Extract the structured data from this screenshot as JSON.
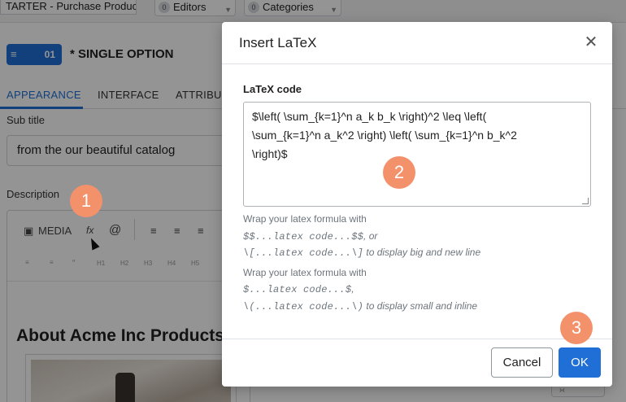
{
  "background": {
    "breadcrumb": "TARTER - Purchase Produc",
    "filters": [
      {
        "count": "0",
        "label": "Editors"
      },
      {
        "count": "0",
        "label": "Categories"
      }
    ],
    "type_badge": {
      "icon": "list-icon",
      "number": "01"
    },
    "page_title": "* SINGLE OPTION",
    "tabs": [
      "APPEARANCE",
      "INTERFACE",
      "ATTRIBUT"
    ],
    "subtitle_label": "Sub title",
    "subtitle_value": "from the our beautiful catalog",
    "description_label": "Description",
    "editor_toolbar": {
      "media": "MEDIA",
      "formula_icon": "fx",
      "mention_icon": "@",
      "align_icons": [
        "align-left-icon",
        "align-center-icon",
        "align-right-icon"
      ],
      "headings": [
        "H1",
        "H2",
        "H3",
        "H4",
        "H5"
      ]
    },
    "editor_heading": "About Acme Inc Products"
  },
  "modal": {
    "title": "Insert LaTeX",
    "field_label": "LaTeX code",
    "latex_value": "$\\left( \\sum_{k=1}^n a_k b_k \\right)^2 \\leq \\left(\n\\sum_{k=1}^n a_k^2 \\right) \\left( \\sum_{k=1}^n b_k^2\n\\right)$",
    "help": {
      "line1": "Wrap your latex formula with",
      "line2_code": "$$...latex code...$$",
      "line2_text": ", or",
      "line3_code": "\\[...latex code...\\]",
      "line3_text": " to display big and new line",
      "line4": "Wrap your latex formula with",
      "line5_code": "$...latex code...$",
      "line5_text": ",",
      "line6_code": "\\(...latex code...\\)",
      "line6_text": " to display small and inline"
    },
    "cancel_label": "Cancel",
    "ok_label": "OK"
  },
  "steps": [
    "1",
    "2",
    "3"
  ],
  "colors": {
    "primary": "#1f6fd6",
    "step_marker": "#f3916b"
  }
}
